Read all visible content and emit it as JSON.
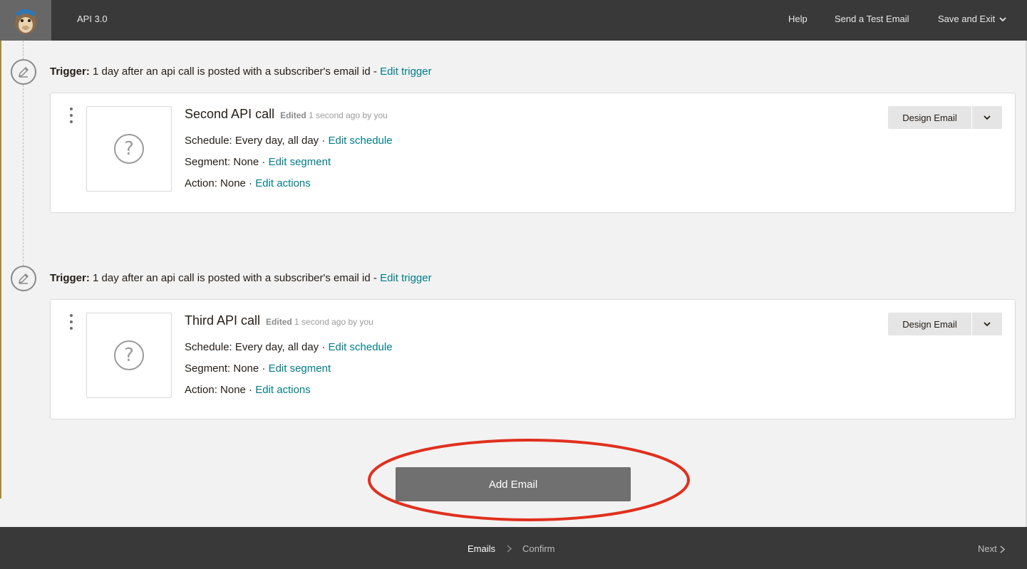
{
  "header": {
    "app_title": "API 3.0",
    "help": "Help",
    "send_test": "Send a Test Email",
    "save_exit": "Save and Exit"
  },
  "emails": [
    {
      "trigger_label": "Trigger:",
      "trigger_text": " 1 day after an api call is posted with a subscriber's email id - ",
      "edit_trigger": "Edit trigger",
      "title": "Second API call",
      "edited_prefix": "Edited",
      "edited_rest": " 1 second ago by you",
      "schedule_label": "Schedule:",
      "schedule_value": " Every day, all day · ",
      "edit_schedule": "Edit schedule",
      "segment_label": "Segment:",
      "segment_value": " None · ",
      "edit_segment": "Edit segment",
      "action_label": "Action:",
      "action_value": " None · ",
      "edit_actions": "Edit actions",
      "design_email": "Design Email"
    },
    {
      "trigger_label": "Trigger:",
      "trigger_text": " 1 day after an api call is posted with a subscriber's email id - ",
      "edit_trigger": "Edit trigger",
      "title": "Third API call",
      "edited_prefix": "Edited",
      "edited_rest": " 1 second ago by you",
      "schedule_label": "Schedule:",
      "schedule_value": " Every day, all day · ",
      "edit_schedule": "Edit schedule",
      "segment_label": "Segment:",
      "segment_value": " None · ",
      "edit_segment": "Edit segment",
      "action_label": "Action:",
      "action_value": " None · ",
      "edit_actions": "Edit actions",
      "design_email": "Design Email"
    }
  ],
  "add_email": "Add Email",
  "footer": {
    "step_emails": "Emails",
    "step_confirm": "Confirm",
    "next": "Next"
  },
  "colors": {
    "topbar": "#393939",
    "link": "#007c89",
    "highlight_ring": "#e0301e",
    "add_button": "#707070"
  },
  "icons": [
    "mailchimp-logo-icon",
    "chevron-down-icon",
    "pencil-icon",
    "question-mark-icon",
    "kebab-menu-icon",
    "chevron-right-icon"
  ]
}
